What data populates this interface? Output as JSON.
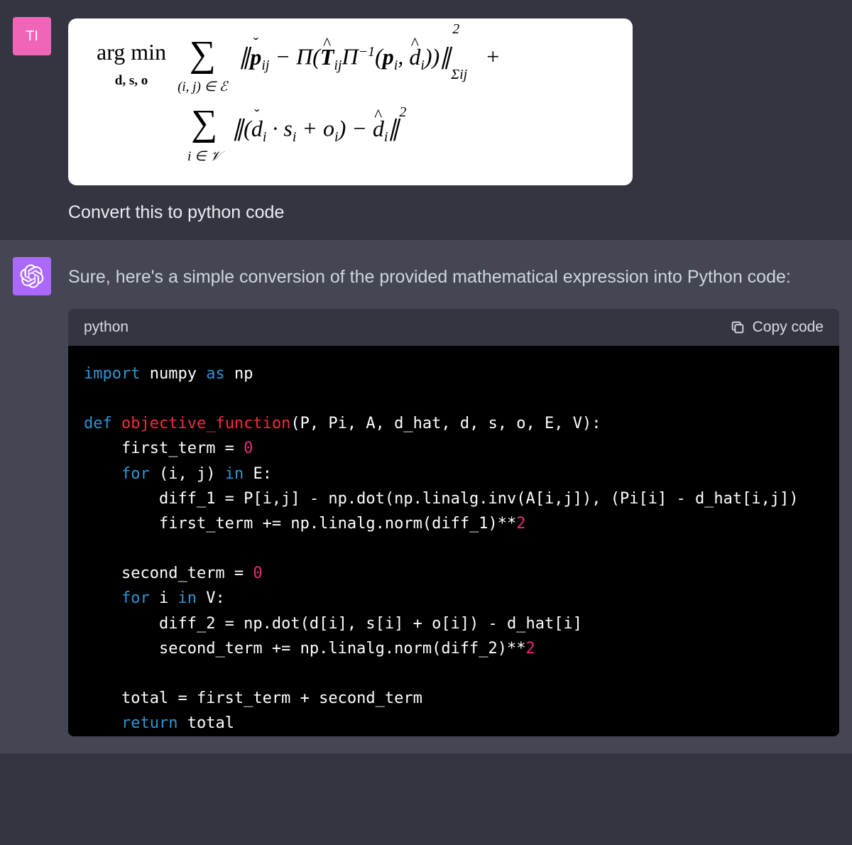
{
  "user": {
    "avatar_label": "TI",
    "prompt": "Convert this to python code",
    "equation": {
      "line1_argmin_top": "arg min",
      "line1_argmin_bottom": "d, s, o",
      "line1_sum_sub": "(i, j) ∈ ℰ",
      "line1_body_prefix": "∥",
      "line1_p_check": "p̌",
      "line1_p_sub": "ij",
      "line1_minus": " − Π(",
      "line1_T_hat": "T̂",
      "line1_T_sub": "ij",
      "line1_Pi_inv": "Π⁻¹(",
      "line1_p_bold": "p",
      "line1_p_bold_sub": "i",
      "line1_comma": ", ",
      "line1_d_hat": "d̂",
      "line1_d_hat_sub": "i",
      "line1_close": "))∥",
      "line1_norm_sub": "Σij",
      "line1_norm_sup": "2",
      "line1_plus": "  +",
      "line2_sum_sub": "i ∈ 𝒱",
      "line2_body": "∥(ďᵢ · sᵢ + oᵢ) − d̂ᵢ∥²"
    }
  },
  "assistant": {
    "intro": "Sure, here's a simple conversion of the provided mathematical expression into Python code:",
    "code_lang": "python",
    "copy_label": "Copy code",
    "code": {
      "l1": {
        "kw1": "import",
        "txt1": " numpy ",
        "kw2": "as",
        "txt2": " np"
      },
      "l2": "",
      "l3": {
        "kw1": "def",
        "fn": " objective_function",
        "params": "(P, Pi, A, d_hat, d, s, o, E, V):"
      },
      "l4": {
        "indent": "    ",
        "txt": "first_term = ",
        "num": "0"
      },
      "l5": {
        "indent": "    ",
        "kw1": "for",
        "txt1": " (i, j) ",
        "kw2": "in",
        "txt2": " E:"
      },
      "l6": {
        "indent": "        ",
        "txt": "diff_1 = P[i,j] - np.dot(np.linalg.inv(A[i,j]), (Pi[i] - d_hat[i,j])"
      },
      "l7": {
        "indent": "        ",
        "txt1": "first_term += np.linalg.norm(diff_1)**",
        "num": "2"
      },
      "l8": "",
      "l9": {
        "indent": "    ",
        "txt": "second_term = ",
        "num": "0"
      },
      "l10": {
        "indent": "    ",
        "kw1": "for",
        "txt1": " i ",
        "kw2": "in",
        "txt2": " V:"
      },
      "l11": {
        "indent": "        ",
        "txt": "diff_2 = np.dot(d[i], s[i] + o[i]) - d_hat[i]"
      },
      "l12": {
        "indent": "        ",
        "txt1": "second_term += np.linalg.norm(diff_2)**",
        "num": "2"
      },
      "l13": "",
      "l14": {
        "indent": "    ",
        "txt": "total = first_term + second_term"
      },
      "l15": {
        "indent": "    ",
        "kw1": "return",
        "txt": " total"
      }
    }
  }
}
